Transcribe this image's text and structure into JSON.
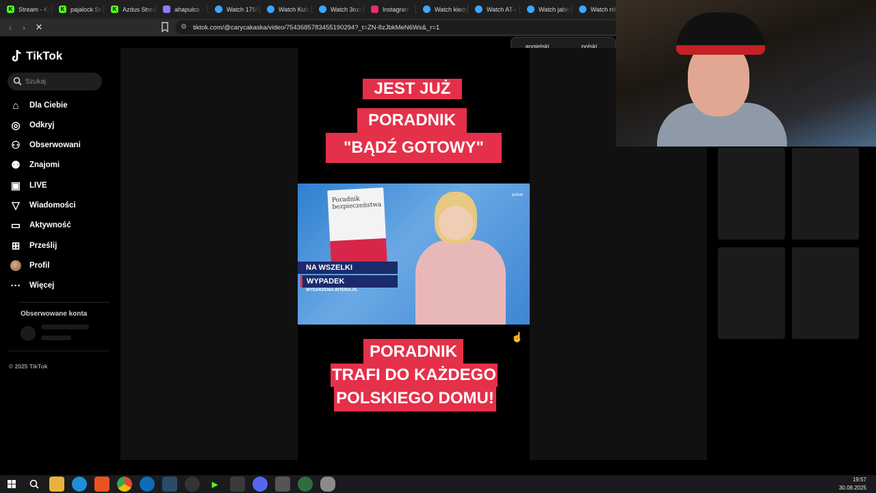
{
  "browser": {
    "tabs": [
      {
        "label": "Stream - Ki",
        "favicon": "kick-icon",
        "color": "#53fc18"
      },
      {
        "label": "pajalock Str",
        "favicon": "kick-icon",
        "color": "#53fc18"
      },
      {
        "label": "Azdus Strea",
        "favicon": "kick-icon",
        "color": "#53fc18"
      },
      {
        "label": "ahapulco - ",
        "favicon": "site-icon",
        "color": "#8a7cff"
      },
      {
        "label": "Watch 1755",
        "favicon": "watch-icon",
        "color": "#3ea6ff"
      },
      {
        "label": "Watch Kubi",
        "favicon": "watch-icon",
        "color": "#3ea6ff"
      },
      {
        "label": "Watch 3ozo",
        "favicon": "watch-icon",
        "color": "#3ea6ff"
      },
      {
        "label": "Instagram",
        "favicon": "instagram-icon",
        "color": "#e1306c"
      },
      {
        "label": "Watch kiedy",
        "favicon": "watch-icon",
        "color": "#3ea6ff"
      },
      {
        "label": "Watch AT-c",
        "favicon": "watch-icon",
        "color": "#3ea6ff"
      },
      {
        "label": "Watch jabło",
        "favicon": "watch-icon",
        "color": "#3ea6ff"
      },
      {
        "label": "Watch rób",
        "favicon": "watch-icon",
        "color": "#3ea6ff"
      }
    ],
    "url": "tiktok.com/@carycakaska/video/7543685783455190294?_t=ZN-8zJbkMeN6Ws&_r=1",
    "translate": {
      "lang_a": "angielski",
      "lang_b": "polski",
      "active": "angielski"
    }
  },
  "tiktok": {
    "logo_text": "TikTok",
    "search_placeholder": "Szukaj",
    "nav": [
      {
        "label": "Dla Ciebie",
        "icon": "home-icon"
      },
      {
        "label": "Odkryj",
        "icon": "compass-icon"
      },
      {
        "label": "Obserwowani",
        "icon": "following-icon"
      },
      {
        "label": "Znajomi",
        "icon": "friends-icon"
      },
      {
        "label": "LIVE",
        "icon": "live-icon"
      },
      {
        "label": "Wiadomości",
        "icon": "messages-icon"
      },
      {
        "label": "Aktywność",
        "icon": "activity-icon"
      },
      {
        "label": "Prześlij",
        "icon": "upload-icon"
      },
      {
        "label": "Profil",
        "icon": "avatar"
      },
      {
        "label": "Więcej",
        "icon": "more-icon"
      }
    ],
    "followed_title": "Obserwowane konta",
    "copyright": "© 2025 TikTok"
  },
  "video": {
    "banner_top": [
      "JEST JUŻ",
      "PORADNIK",
      "\"BĄDŹ GOTOWY\""
    ],
    "banner_bottom": [
      "PORADNIK",
      "TRAFI DO KAŻDEGO",
      "POLSKIEGO DOMU!"
    ],
    "news": {
      "book_title": "Poradnik bezpieczeństwa",
      "lower_third_1": "NA WSZELKI",
      "lower_third_2": "WYPADEK",
      "source": "WYDARZENIA.INTERIA.PL",
      "channel": "polsat"
    },
    "accent_color": "#e5304a"
  },
  "taskbar": {
    "time": "19:57",
    "date": "30.08.2025"
  }
}
